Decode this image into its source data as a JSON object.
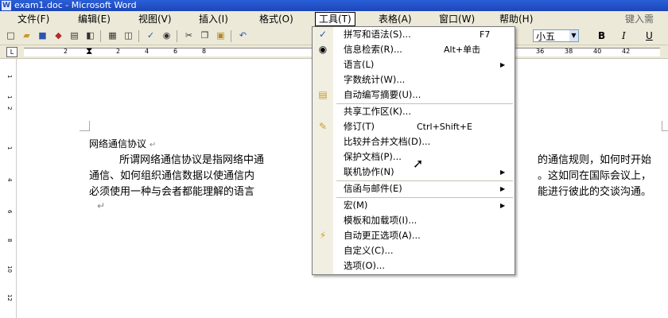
{
  "window": {
    "title": "exam1.doc - Microsoft Word",
    "icon": "word-document-icon"
  },
  "menubar": {
    "items": [
      {
        "label": "文件(F)"
      },
      {
        "label": "编辑(E)"
      },
      {
        "label": "视图(V)"
      },
      {
        "label": "插入(I)"
      },
      {
        "label": "格式(O)"
      },
      {
        "label": "工具(T)"
      },
      {
        "label": "表格(A)"
      },
      {
        "label": "窗口(W)"
      },
      {
        "label": "帮助(H)"
      }
    ],
    "help_search": "键入需"
  },
  "toolbar": {
    "font_size": "小五",
    "bold": "B",
    "italic": "I",
    "underline": "U"
  },
  "ruler": {
    "tab_selector": "L",
    "ticks": [
      "2",
      "2",
      "4",
      "6",
      "8",
      "36",
      "38",
      "40",
      "42"
    ],
    "vertical_ticks": [
      "1",
      "1",
      "2",
      "1",
      "4",
      "6",
      "8",
      "10",
      "12"
    ]
  },
  "document": {
    "heading": "网络通信协议",
    "para_line1_a": "所谓网络通信协议是指网络中通",
    "para_line1_b": "的通信规则，如何时开始",
    "para_line2_a": "通信、如何组织通信数据以使通信内",
    "para_line2_b": "。这如同在国际会议上，",
    "para_line3_a": "必须使用一种与会者都能理解的语言",
    "para_line3_b": "能进行彼此的交谈沟通。",
    "para_mark": "↵"
  },
  "tools_menu": {
    "items": [
      {
        "label": "拼写和语法(S)...",
        "shortcut": "F7",
        "icon": "spelling-grammar-icon"
      },
      {
        "label": "信息检索(R)...",
        "shortcut": "Alt+单击",
        "icon": "research-icon"
      },
      {
        "label": "语言(L)",
        "submenu": true
      },
      {
        "label": "字数统计(W)..."
      },
      {
        "label": "自动编写摘要(U)...",
        "icon": "autosummarize-icon"
      },
      {
        "label": "共享工作区(K)..."
      },
      {
        "label": "修订(T)",
        "shortcut": "Ctrl+Shift+E",
        "icon": "track-changes-icon"
      },
      {
        "label": "比较并合并文档(D)..."
      },
      {
        "label": "保护文档(P)..."
      },
      {
        "label": "联机协作(N)",
        "submenu": true
      },
      {
        "label": "信函与邮件(E)",
        "submenu": true
      },
      {
        "label": "宏(M)",
        "submenu": true
      },
      {
        "label": "模板和加载项(I)..."
      },
      {
        "label": "自动更正选项(A)...",
        "icon": "autocorrect-icon"
      },
      {
        "label": "自定义(C)..."
      },
      {
        "label": "选项(O)..."
      }
    ]
  }
}
